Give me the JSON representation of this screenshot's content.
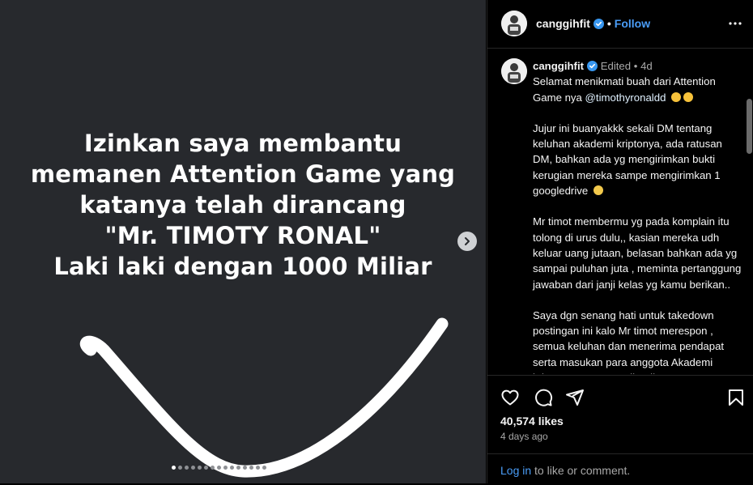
{
  "post": {
    "image_text": [
      "Izinkan saya membantu",
      "memanen Attention Game yang",
      "katanya telah dirancang",
      "\"Mr. TIMOTY RONAL\"",
      "Laki laki dengan 1000 Miliar"
    ],
    "carousel": {
      "total": 15,
      "active_index": 0
    }
  },
  "header": {
    "username": "canggihfit",
    "separator": "•",
    "follow_label": "Follow"
  },
  "caption": {
    "username": "canggihfit",
    "edited_label": "Edited",
    "age": "4d",
    "line1": "Selamat menikmati buah dari Attention Game nya ",
    "mention": "@timothyronaldd",
    "para2": "Jujur ini buanyakkk sekali DM tentang keluhan akademi kriptonya, ada ratusan DM, bahkan ada yg mengirimkan bukti kerugian mereka sampe mengirimkan 1 googledrive",
    "para3": " Mr timot membermu yg pada komplain itu tolong di urus dulu,, kasian mereka udh keluar uang jutaan, belasan bahkan ada yg sampai puluhan juta , meminta pertanggung jawaban dari janji kelas yg kamu berikan..",
    "para4": "Saya dgn senang hati untuk takedown postingan ini kalo Mr timot merespon , semua keluhan dan menerima pendapat serta masukan para anggota Akademi kripto yang merasa dirugikan"
  },
  "stats": {
    "likes": "40,574 likes",
    "time": "4 days ago"
  },
  "footer": {
    "login_link": "Log in",
    "login_rest": " to like or comment."
  },
  "icons": [
    "heart-icon",
    "comment-icon",
    "share-icon",
    "bookmark-icon",
    "more-icon",
    "verified-icon",
    "chevron-right-icon"
  ],
  "colors": {
    "accent": "#4a9df8",
    "verified": "#3897f0",
    "media_bg": "#27292d"
  }
}
